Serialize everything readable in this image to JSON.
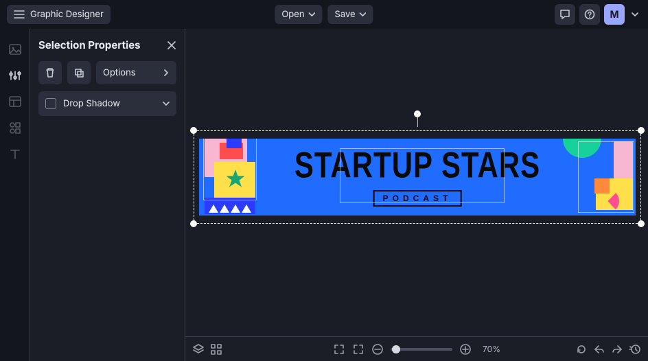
{
  "app": {
    "title": "Graphic Designer"
  },
  "header": {
    "open_label": "Open",
    "save_label": "Save",
    "avatar_initial": "M"
  },
  "panel": {
    "title": "Selection Properties",
    "options_label": "Options",
    "drop_shadow_label": "Drop Shadow"
  },
  "canvas": {
    "banner_title": "STARTUP STARS",
    "banner_subtitle": "PODCAST"
  },
  "footer": {
    "zoom_label": "70%"
  }
}
